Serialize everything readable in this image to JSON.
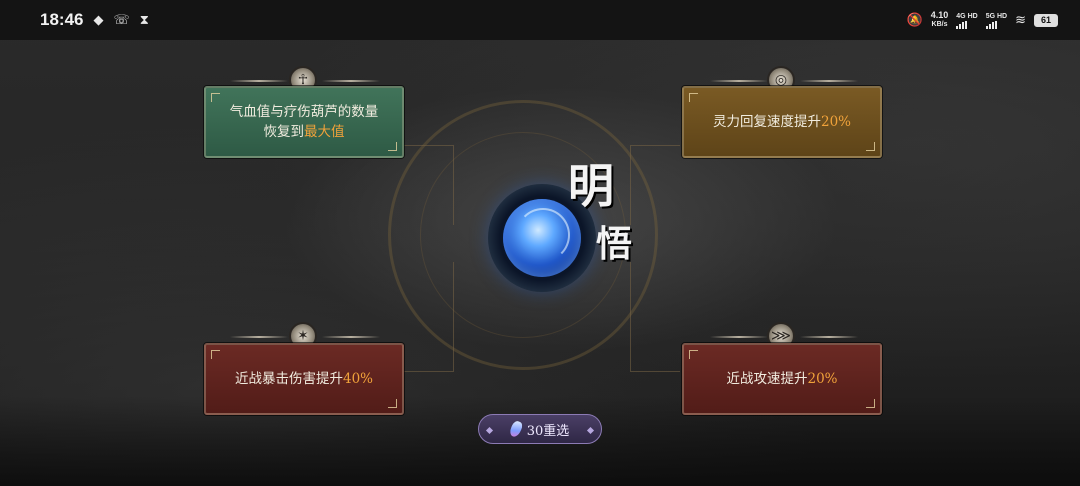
{
  "status_bar": {
    "time": "18:46",
    "speed_value": "4.10",
    "speed_unit": "KB/s",
    "network_1": "4G HD",
    "network_2": "5G HD",
    "battery": "61"
  },
  "title": {
    "char_1": "明",
    "char_2": "悟"
  },
  "cards": {
    "top_left": {
      "line1": "气血值与疗伤葫芦的数量",
      "line2_prefix": "恢复到",
      "line2_highlight": "最大值",
      "badge_icon": "gourd-icon"
    },
    "top_right": {
      "prefix": "灵力回复速度提升",
      "highlight": "20%",
      "badge_icon": "spirit-icon"
    },
    "bottom_left": {
      "prefix": "近战暴击伤害提升",
      "highlight": "40%",
      "badge_icon": "crit-icon"
    },
    "bottom_right": {
      "prefix": "近战攻速提升",
      "highlight": "20%",
      "badge_icon": "claw-icon"
    }
  },
  "reroll": {
    "label": "30重选",
    "icon": "crystal-icon"
  },
  "colors": {
    "highlight": "#f0a23a",
    "green_card": "#41745a",
    "gold_card": "#7a5a24",
    "red_card": "#6b2a24",
    "reroll_button": "#4a3f66"
  }
}
